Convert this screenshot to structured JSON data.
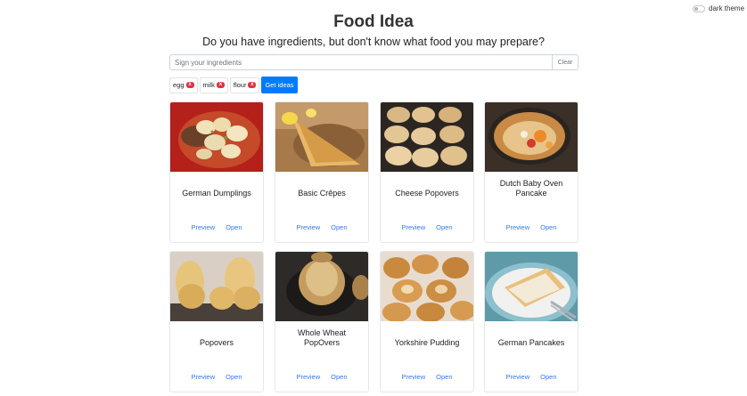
{
  "theme": {
    "label": "dark theme"
  },
  "header": {
    "title": "Food Idea",
    "subtitle": "Do you have ingredients, but don't know what food you may prepare?"
  },
  "search": {
    "placeholder": "Sign your ingredients",
    "value": "",
    "clear_label": "Clear"
  },
  "ingredients": [
    {
      "label": "egg",
      "remove": "x"
    },
    {
      "label": "milk",
      "remove": "x"
    },
    {
      "label": "flour",
      "remove": "x"
    }
  ],
  "ideas_button": "Get ideas",
  "recipes": [
    {
      "title": "German Dumplings",
      "preview": "Preview",
      "open": "Open"
    },
    {
      "title": "Basic Crêpes",
      "preview": "Preview",
      "open": "Open"
    },
    {
      "title": "Cheese Popovers",
      "preview": "Preview",
      "open": "Open"
    },
    {
      "title": "Dutch Baby Oven Pancake",
      "preview": "Preview",
      "open": "Open"
    },
    {
      "title": "Popovers",
      "preview": "Preview",
      "open": "Open"
    },
    {
      "title": "Whole Wheat PopOvers",
      "preview": "Preview",
      "open": "Open"
    },
    {
      "title": "Yorkshire Pudding",
      "preview": "Preview",
      "open": "Open"
    },
    {
      "title": "German Pancakes",
      "preview": "Preview",
      "open": "Open"
    }
  ],
  "colors": {
    "primary": "#007bff",
    "danger": "#dc3545",
    "link": "#3478f6"
  }
}
